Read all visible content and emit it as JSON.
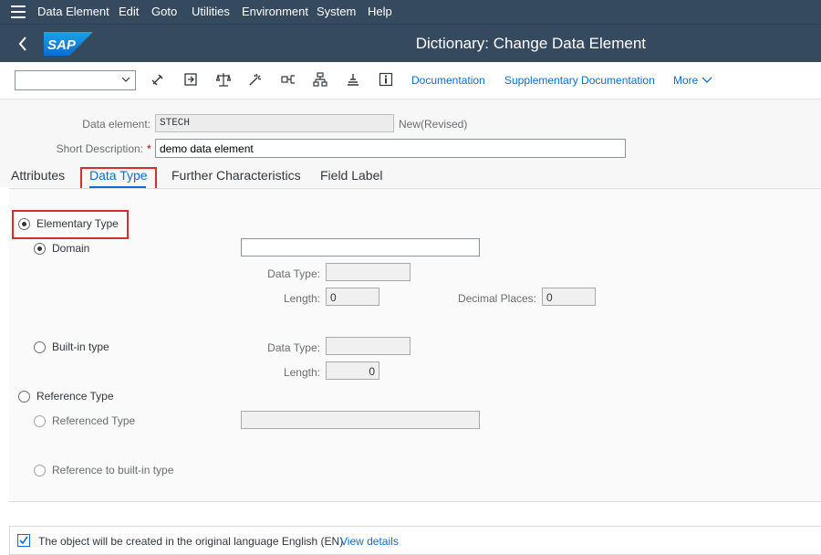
{
  "menu": {
    "items": [
      "Data Element",
      "Edit",
      "Goto",
      "Utilities",
      "Environment",
      "System",
      "Help"
    ]
  },
  "header": {
    "logo_text": "SAP",
    "title": "Dictionary: Change Data Element"
  },
  "toolbar": {
    "combo_value": "",
    "icons": [
      "display-other-icon",
      "activate-icon",
      "check-icon",
      "where-used-icon",
      "navigate-icon",
      "hierarchy-icon",
      "transport-icon",
      "info-icon"
    ],
    "links": [
      "Documentation",
      "Supplementary Documentation"
    ],
    "more_label": "More"
  },
  "form": {
    "data_element_label": "Data element:",
    "data_element_value": "STECH",
    "data_element_status": "New(Revised)",
    "short_desc_label": "Short Description:",
    "required_mark": "*",
    "short_desc_value": "demo data element"
  },
  "tabs": [
    "Attributes",
    "Data Type",
    "Further Characteristics",
    "Field Label"
  ],
  "active_tab": "Data Type",
  "data_type_panel": {
    "elementary_type_label": "Elementary Type",
    "domain_label": "Domain",
    "domain_value": "",
    "domain_data_type_label": "Data Type:",
    "domain_data_type_value": "",
    "domain_length_label": "Length:",
    "domain_length_value": "0",
    "decimal_places_label": "Decimal Places:",
    "decimal_places_value": "0",
    "builtin_label": "Built-in type",
    "builtin_data_type_label": "Data Type:",
    "builtin_data_type_value": "",
    "builtin_length_label": "Length:",
    "builtin_length_value": "0",
    "reference_type_label": "Reference Type",
    "referenced_type_label": "Referenced Type",
    "referenced_type_value": "",
    "reference_builtin_label": "Reference to built-in type"
  },
  "footer": {
    "message": "The object will be created in the original language English (EN)",
    "link": "View details"
  },
  "colors": {
    "shell": "#354a5f",
    "link": "#0a6ed1",
    "highlight_box": "#d32f2f"
  }
}
